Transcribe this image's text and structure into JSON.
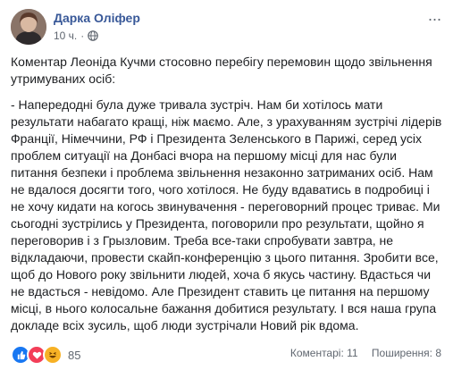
{
  "post": {
    "author": "Дарка Оліфер",
    "time": "10 ч.",
    "time_sep": "·",
    "more_label": "...",
    "paragraphs": [
      "Коментар Леоніда Кучми стосовно перебігу перемовин щодо звільнення утримуваних осіб:",
      "- Напередодні була дуже тривала зустріч. Нам би хотілось мати результати набагато кращі, ніж маємо. Але, з урахуванням зустрічі лідерів Франції, Німеччини, РФ і Президента Зеленського в Парижі, серед усіх проблем ситуації на Донбасі вчора на першому місці для нас були питання безпеки і проблема звільнення незаконно затриманих осіб. Нам не вдалося досягти того, чого хотілося. Не буду вдаватись в подробиці і не хочу кидати на когось звинувачення - переговорний процес триває. Ми сьогодні зустрілись у Президента, поговорили про результати, щойно я переговорив і з Грызловим. Треба все-таки спробувати завтра, не відкладаючи, провести скайп-конференцію з цього питання. Зробити все, щоб до Нового року звільнити людей, хоча б якусь частину. Вдасться чи не вдасться - невідомо. Але Президент ставить це питання на першому місці, в нього колосальне бажання добитися результату. І вся наша група докладе всіх зусиль, щоб люди зустрічали Новий рік вдома."
    ]
  },
  "footer": {
    "reaction_icons": [
      "like-icon",
      "love-icon",
      "haha-icon"
    ],
    "reaction_count": "85",
    "comments": "Коментарі: 11",
    "shares": "Поширення: 8"
  },
  "colors": {
    "author": "#385898",
    "like": "#1877f2",
    "love": "#f33e58",
    "haha": "#f7b125",
    "meta": "#606770"
  }
}
